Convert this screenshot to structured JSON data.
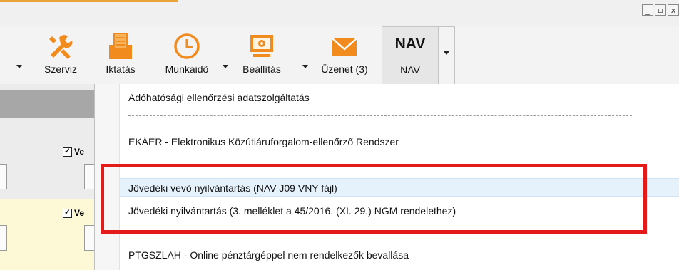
{
  "window": {
    "buttons": [
      "_",
      "▫",
      "x"
    ]
  },
  "toolbar": {
    "items": [
      {
        "label": "Szerviz",
        "icon": "tools-icon"
      },
      {
        "label": "Iktatás",
        "icon": "filing-icon"
      },
      {
        "label": "Munkaidő",
        "icon": "clock-icon"
      },
      {
        "label": "Beállítás",
        "icon": "settings-monitor-icon"
      },
      {
        "label": "Üzenet (3)",
        "icon": "envelope-icon"
      },
      {
        "label": "NAV",
        "icon": "nav-text-icon",
        "icon_text": "NAV"
      }
    ]
  },
  "left_pane": {
    "checkbox1": "Ve",
    "checkbox2": "Ve"
  },
  "menu": {
    "items": [
      {
        "label": "Adóhatósági ellenőrzési adatszolgáltatás"
      },
      {
        "label": "EKÁER - Elektronikus Közútiáruforgalom-ellenőrző Rendszer"
      },
      {
        "label": "Jövedéki vevő nyilvántartás (NAV J09 VNY fájl)",
        "highlighted": true
      },
      {
        "label": "Jövedéki nyilvántartás (3. melléklet a 45/2016. (XI. 29.) NGM rendelethez)"
      },
      {
        "label": "PTGSZLAH - Online pénztárgéppel nem rendelkezők bevallása"
      }
    ]
  },
  "colors": {
    "accent_orange": "#f28b1e",
    "highlight_box": "#e31b1b",
    "hover_row": "#e5f1fb"
  }
}
